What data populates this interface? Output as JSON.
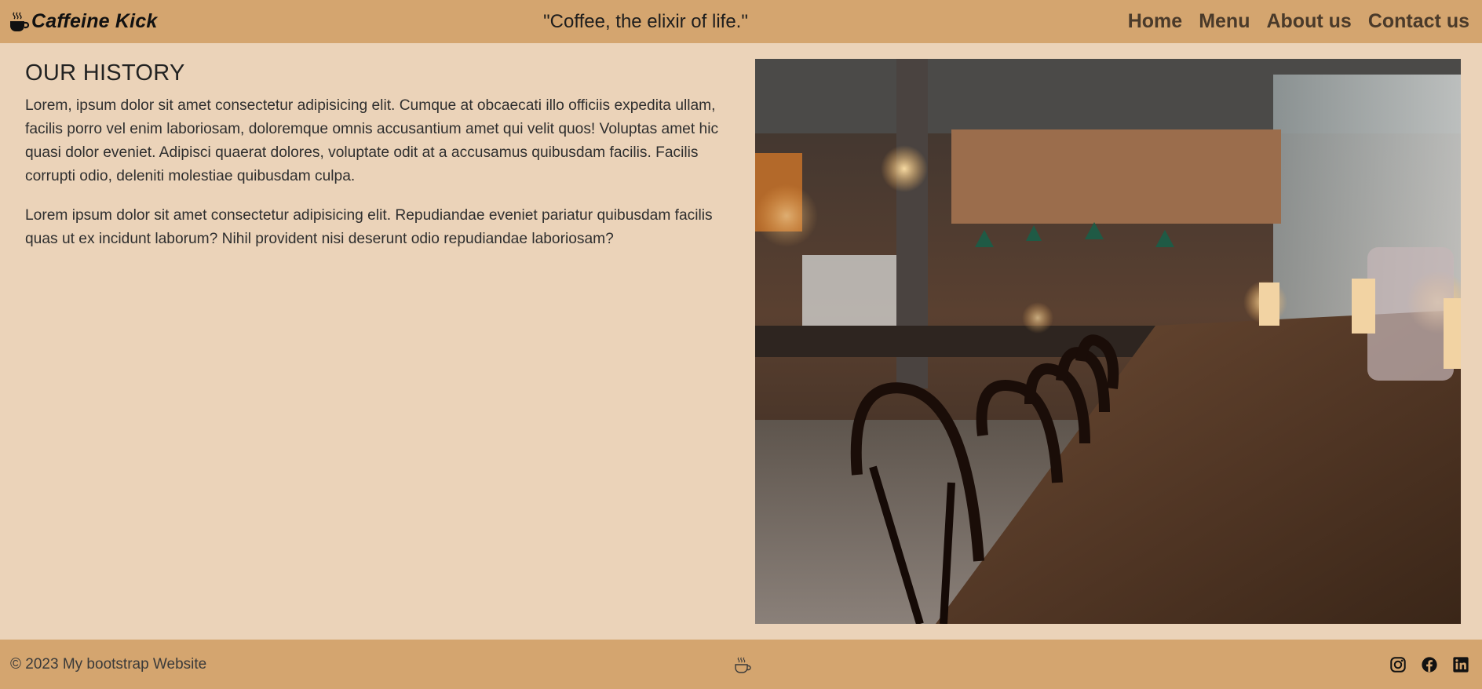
{
  "navbar": {
    "brand": "Caffeine Kick",
    "tagline": "\"Coffee, the elixir of life.\"",
    "links": [
      "Home",
      "Menu",
      "About us",
      "Contact us"
    ]
  },
  "main": {
    "heading": "OUR HISTORY",
    "paragraphs": [
      "Lorem, ipsum dolor sit amet consectetur adipisicing elit. Cumque at obcaecati illo officiis expedita ullam, facilis porro vel enim laboriosam, doloremque omnis accusantium amet qui velit quos! Voluptas amet hic quasi dolor eveniet. Adipisci quaerat dolores, voluptate odit at a accusamus quibusdam facilis. Facilis corrupti odio, deleniti molestiae quibusdam culpa.",
      "Lorem ipsum dolor sit amet consectetur adipisicing elit. Repudiandae eveniet pariatur quibusdam facilis quas ut ex incidunt laborum? Nihil provident nisi deserunt odio repudiandae laboriosam?"
    ],
    "image": "cafe-interior-photo"
  },
  "footer": {
    "copyright": "© 2023 My bootstrap Website",
    "center_icon": "coffee-cup-icon",
    "socials": [
      "instagram-icon",
      "facebook-icon",
      "linkedin-icon"
    ]
  },
  "colors": {
    "navbar_bg": "#d4a56f",
    "page_bg": "#ebd3b9",
    "nav_link": "#4a3a2a"
  }
}
